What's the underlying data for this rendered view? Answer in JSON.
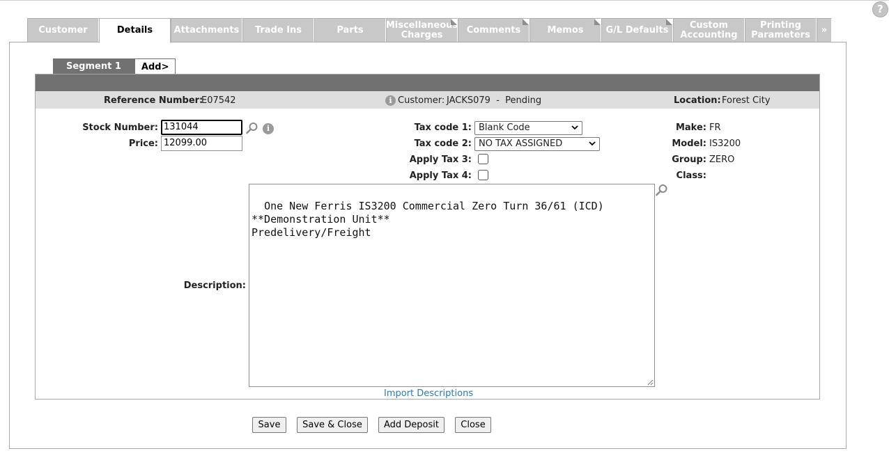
{
  "help": {
    "label": "?"
  },
  "tabs": [
    {
      "label": "Customer"
    },
    {
      "label": "Details"
    },
    {
      "label": "Attachments"
    },
    {
      "label": "Trade Ins"
    },
    {
      "label": "Parts"
    },
    {
      "label": "Miscellaneous Charges"
    },
    {
      "label": "Comments"
    },
    {
      "label": "Memos"
    },
    {
      "label": "G/L Defaults"
    },
    {
      "label": "Custom Accounting"
    },
    {
      "label": "Printing Parameters"
    },
    {
      "label": "»"
    }
  ],
  "segments": {
    "active": "Segment 1",
    "add": "Add>"
  },
  "info": {
    "reference_label": "Reference Number:",
    "reference_value": "E07542",
    "customer_label": "Customer:",
    "customer_value": "JACKS079  -  Pending",
    "location_label": "Location:",
    "location_value": "Forest City"
  },
  "form": {
    "stock_label": "Stock Number:",
    "stock_value": "131044",
    "price_label": "Price:",
    "price_value": "12099.00",
    "tax1_label": "Tax code 1:",
    "tax1_value": "Blank Code",
    "tax2_label": "Tax code 2:",
    "tax2_value": "NO TAX ASSIGNED",
    "tax3_label": "Apply Tax 3:",
    "tax4_label": "Apply Tax 4:",
    "make_label": "Make:",
    "make_value": "FR",
    "model_label": "Model:",
    "model_value": "IS3200",
    "group_label": "Group:",
    "group_value": "ZERO",
    "class_label": "Class:",
    "class_value": "",
    "description_label": "Description:",
    "description_value": "One New Ferris IS3200 Commercial Zero Turn 36/61 (ICD)\n**Demonstration Unit**\nPredelivery/Freight",
    "import_link": "Import Descriptions"
  },
  "buttons": {
    "save": "Save",
    "save_close": "Save & Close",
    "add_deposit": "Add Deposit",
    "close": "Close"
  }
}
